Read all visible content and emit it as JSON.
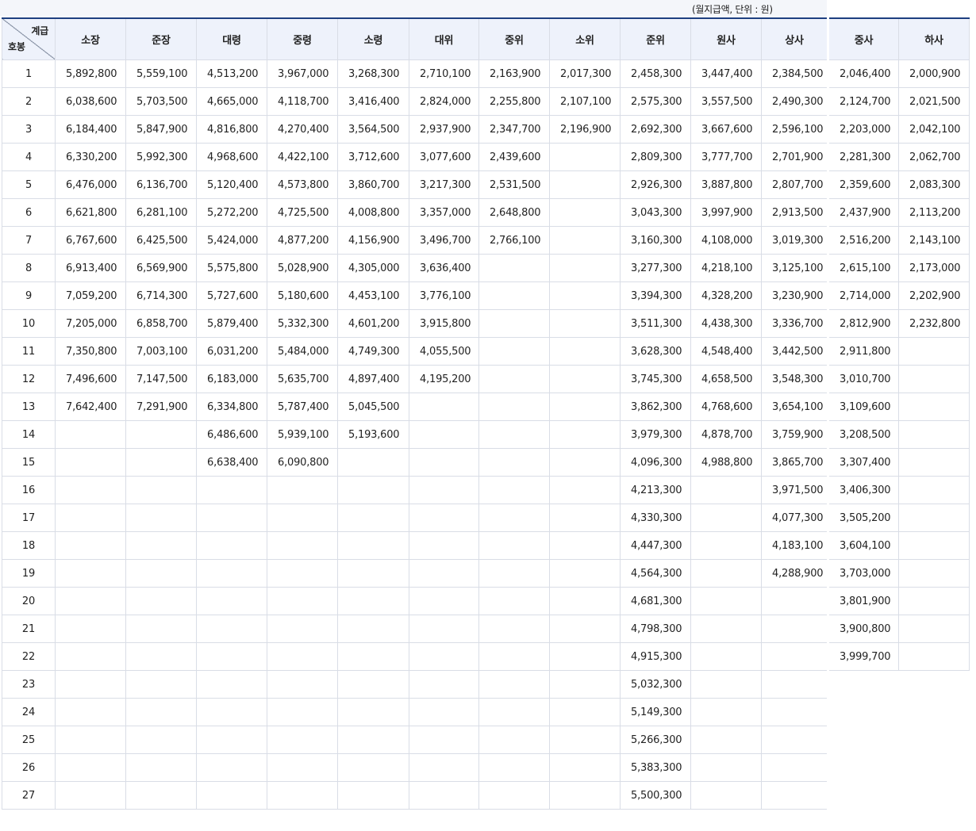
{
  "unit_note": "(월지급액, 단위 : 원)",
  "corner": {
    "top": "계급",
    "bottom": "호봉"
  },
  "ranks": [
    "소장",
    "준장",
    "대령",
    "중령",
    "소령",
    "대위",
    "중위",
    "소위",
    "준위",
    "원사",
    "상사",
    "중사",
    "하사"
  ],
  "rows": [
    [
      "1",
      "5,892,800",
      "5,559,100",
      "4,513,200",
      "3,967,000",
      "3,268,300",
      "2,710,100",
      "2,163,900",
      "2,017,300",
      "2,458,300",
      "3,447,400",
      "2,384,500",
      "2,046,400",
      "2,000,900"
    ],
    [
      "2",
      "6,038,600",
      "5,703,500",
      "4,665,000",
      "4,118,700",
      "3,416,400",
      "2,824,000",
      "2,255,800",
      "2,107,100",
      "2,575,300",
      "3,557,500",
      "2,490,300",
      "2,124,700",
      "2,021,500"
    ],
    [
      "3",
      "6,184,400",
      "5,847,900",
      "4,816,800",
      "4,270,400",
      "3,564,500",
      "2,937,900",
      "2,347,700",
      "2,196,900",
      "2,692,300",
      "3,667,600",
      "2,596,100",
      "2,203,000",
      "2,042,100"
    ],
    [
      "4",
      "6,330,200",
      "5,992,300",
      "4,968,600",
      "4,422,100",
      "3,712,600",
      "3,077,600",
      "2,439,600",
      "",
      "2,809,300",
      "3,777,700",
      "2,701,900",
      "2,281,300",
      "2,062,700"
    ],
    [
      "5",
      "6,476,000",
      "6,136,700",
      "5,120,400",
      "4,573,800",
      "3,860,700",
      "3,217,300",
      "2,531,500",
      "",
      "2,926,300",
      "3,887,800",
      "2,807,700",
      "2,359,600",
      "2,083,300"
    ],
    [
      "6",
      "6,621,800",
      "6,281,100",
      "5,272,200",
      "4,725,500",
      "4,008,800",
      "3,357,000",
      "2,648,800",
      "",
      "3,043,300",
      "3,997,900",
      "2,913,500",
      "2,437,900",
      "2,113,200"
    ],
    [
      "7",
      "6,767,600",
      "6,425,500",
      "5,424,000",
      "4,877,200",
      "4,156,900",
      "3,496,700",
      "2,766,100",
      "",
      "3,160,300",
      "4,108,000",
      "3,019,300",
      "2,516,200",
      "2,143,100"
    ],
    [
      "8",
      "6,913,400",
      "6,569,900",
      "5,575,800",
      "5,028,900",
      "4,305,000",
      "3,636,400",
      "",
      "",
      "3,277,300",
      "4,218,100",
      "3,125,100",
      "2,615,100",
      "2,173,000"
    ],
    [
      "9",
      "7,059,200",
      "6,714,300",
      "5,727,600",
      "5,180,600",
      "4,453,100",
      "3,776,100",
      "",
      "",
      "3,394,300",
      "4,328,200",
      "3,230,900",
      "2,714,000",
      "2,202,900"
    ],
    [
      "10",
      "7,205,000",
      "6,858,700",
      "5,879,400",
      "5,332,300",
      "4,601,200",
      "3,915,800",
      "",
      "",
      "3,511,300",
      "4,438,300",
      "3,336,700",
      "2,812,900",
      "2,232,800"
    ],
    [
      "11",
      "7,350,800",
      "7,003,100",
      "6,031,200",
      "5,484,000",
      "4,749,300",
      "4,055,500",
      "",
      "",
      "3,628,300",
      "4,548,400",
      "3,442,500",
      "2,911,800",
      ""
    ],
    [
      "12",
      "7,496,600",
      "7,147,500",
      "6,183,000",
      "5,635,700",
      "4,897,400",
      "4,195,200",
      "",
      "",
      "3,745,300",
      "4,658,500",
      "3,548,300",
      "3,010,700",
      ""
    ],
    [
      "13",
      "7,642,400",
      "7,291,900",
      "6,334,800",
      "5,787,400",
      "5,045,500",
      "",
      "",
      "",
      "3,862,300",
      "4,768,600",
      "3,654,100",
      "3,109,600",
      ""
    ],
    [
      "14",
      "",
      "",
      "6,486,600",
      "5,939,100",
      "5,193,600",
      "",
      "",
      "",
      "3,979,300",
      "4,878,700",
      "3,759,900",
      "3,208,500",
      ""
    ],
    [
      "15",
      "",
      "",
      "6,638,400",
      "6,090,800",
      "",
      "",
      "",
      "",
      "4,096,300",
      "4,988,800",
      "3,865,700",
      "3,307,400",
      ""
    ],
    [
      "16",
      "",
      "",
      "",
      "",
      "",
      "",
      "",
      "",
      "4,213,300",
      "",
      "3,971,500",
      "3,406,300",
      ""
    ],
    [
      "17",
      "",
      "",
      "",
      "",
      "",
      "",
      "",
      "",
      "4,330,300",
      "",
      "4,077,300",
      "3,505,200",
      ""
    ],
    [
      "18",
      "",
      "",
      "",
      "",
      "",
      "",
      "",
      "",
      "4,447,300",
      "",
      "4,183,100",
      "3,604,100",
      ""
    ],
    [
      "19",
      "",
      "",
      "",
      "",
      "",
      "",
      "",
      "",
      "4,564,300",
      "",
      "4,288,900",
      "3,703,000",
      ""
    ],
    [
      "20",
      "",
      "",
      "",
      "",
      "",
      "",
      "",
      "",
      "4,681,300",
      "",
      "",
      "3,801,900",
      ""
    ],
    [
      "21",
      "",
      "",
      "",
      "",
      "",
      "",
      "",
      "",
      "4,798,300",
      "",
      "",
      "3,900,800",
      ""
    ],
    [
      "22",
      "",
      "",
      "",
      "",
      "",
      "",
      "",
      "",
      "4,915,300",
      "",
      "",
      "3,999,700",
      ""
    ],
    [
      "23",
      "",
      "",
      "",
      "",
      "",
      "",
      "",
      "",
      "5,032,300",
      "",
      "",
      "",
      ""
    ],
    [
      "24",
      "",
      "",
      "",
      "",
      "",
      "",
      "",
      "",
      "5,149,300",
      "",
      "",
      "",
      ""
    ],
    [
      "25",
      "",
      "",
      "",
      "",
      "",
      "",
      "",
      "",
      "5,266,300",
      "",
      "",
      "",
      ""
    ],
    [
      "26",
      "",
      "",
      "",
      "",
      "",
      "",
      "",
      "",
      "5,383,300",
      "",
      "",
      "",
      ""
    ],
    [
      "27",
      "",
      "",
      "",
      "",
      "",
      "",
      "",
      "",
      "5,500,300",
      "",
      "",
      "",
      ""
    ]
  ]
}
